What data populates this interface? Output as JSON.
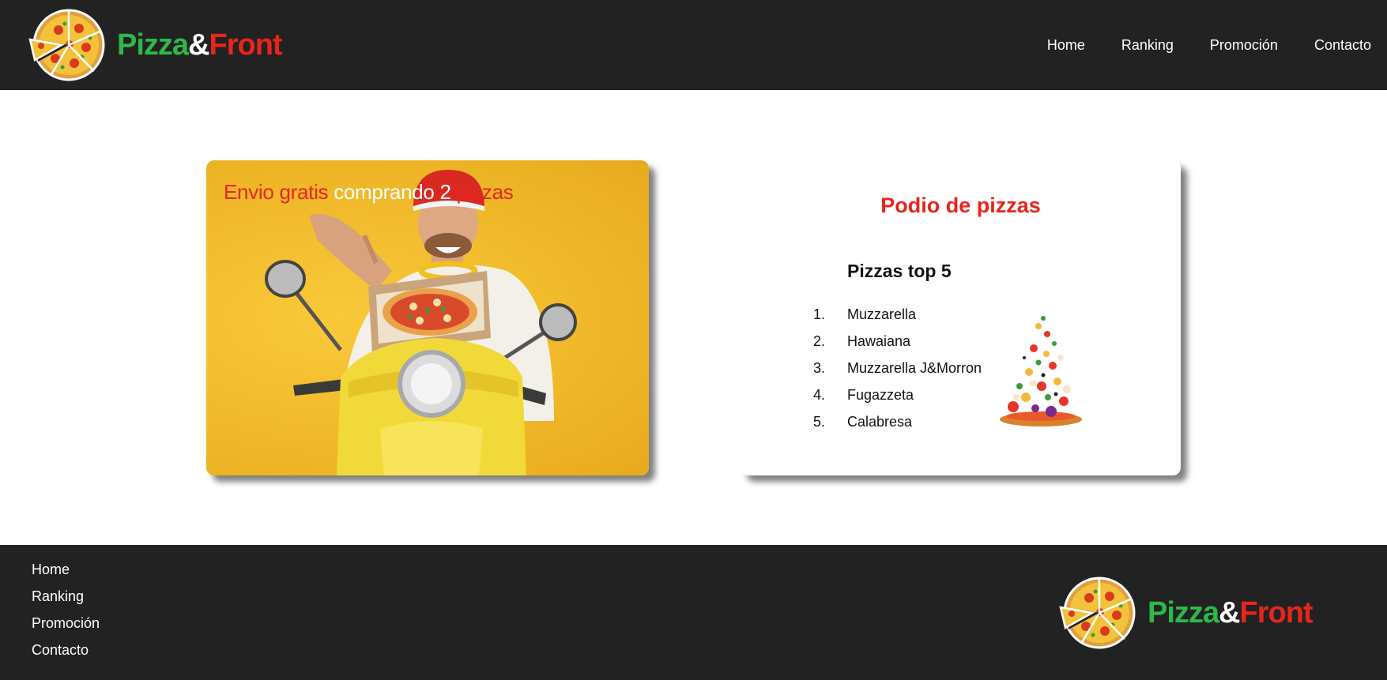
{
  "header": {
    "brand": {
      "part1": "Pizza",
      "amp": "&",
      "part2": "Front"
    },
    "nav": [
      "Home",
      "Ranking",
      "Promoción",
      "Contacto"
    ]
  },
  "promo": {
    "title_part1": "Envio gratis",
    "title_part2": "comprando 2",
    "title_part3": "pizzas"
  },
  "podium": {
    "title": "Podio de pizzas",
    "heading": "Pizzas top 5",
    "items": [
      {
        "num": "1.",
        "name": "Muzzarella"
      },
      {
        "num": "2.",
        "name": "Hawaiana"
      },
      {
        "num": "3.",
        "name": "Muzzarella J&Morron"
      },
      {
        "num": "4.",
        "name": "Fugazzeta"
      },
      {
        "num": "5.",
        "name": "Calabresa"
      }
    ]
  },
  "footer": {
    "nav": [
      "Home",
      "Ranking",
      "Promoción",
      "Contacto"
    ],
    "brand": {
      "part1": "Pizza",
      "amp": "&",
      "part2": "Front"
    }
  },
  "colors": {
    "header_bg": "#222222",
    "brand_green": "#2eb84a",
    "brand_red": "#e8251c",
    "promo_yellow": "#f0b92a"
  },
  "icons": [
    "pizza-logo-icon",
    "delivery-scooter-image",
    "flying-pizza-ingredients-image"
  ]
}
